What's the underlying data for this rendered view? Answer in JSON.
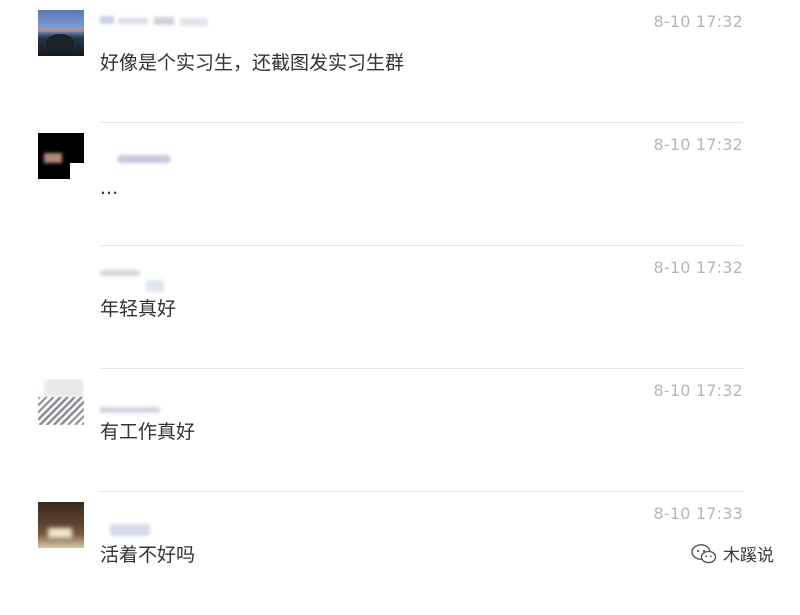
{
  "comments": [
    {
      "time": "8-10 17:32",
      "text": "好像是个实习生，还截图发实习生群"
    },
    {
      "time": "8-10 17:32",
      "text": "..."
    },
    {
      "time": "8-10 17:32",
      "text": "年轻真好"
    },
    {
      "time": "8-10 17:32",
      "text": "有工作真好"
    },
    {
      "time": "8-10 17:33",
      "text": "活着不好吗"
    }
  ],
  "watermark": {
    "text": "木蹊说",
    "icon": "wechat-icon"
  },
  "colors": {
    "time": "#b6b6b6",
    "text": "#333333",
    "divider": "#e6e6e6"
  }
}
